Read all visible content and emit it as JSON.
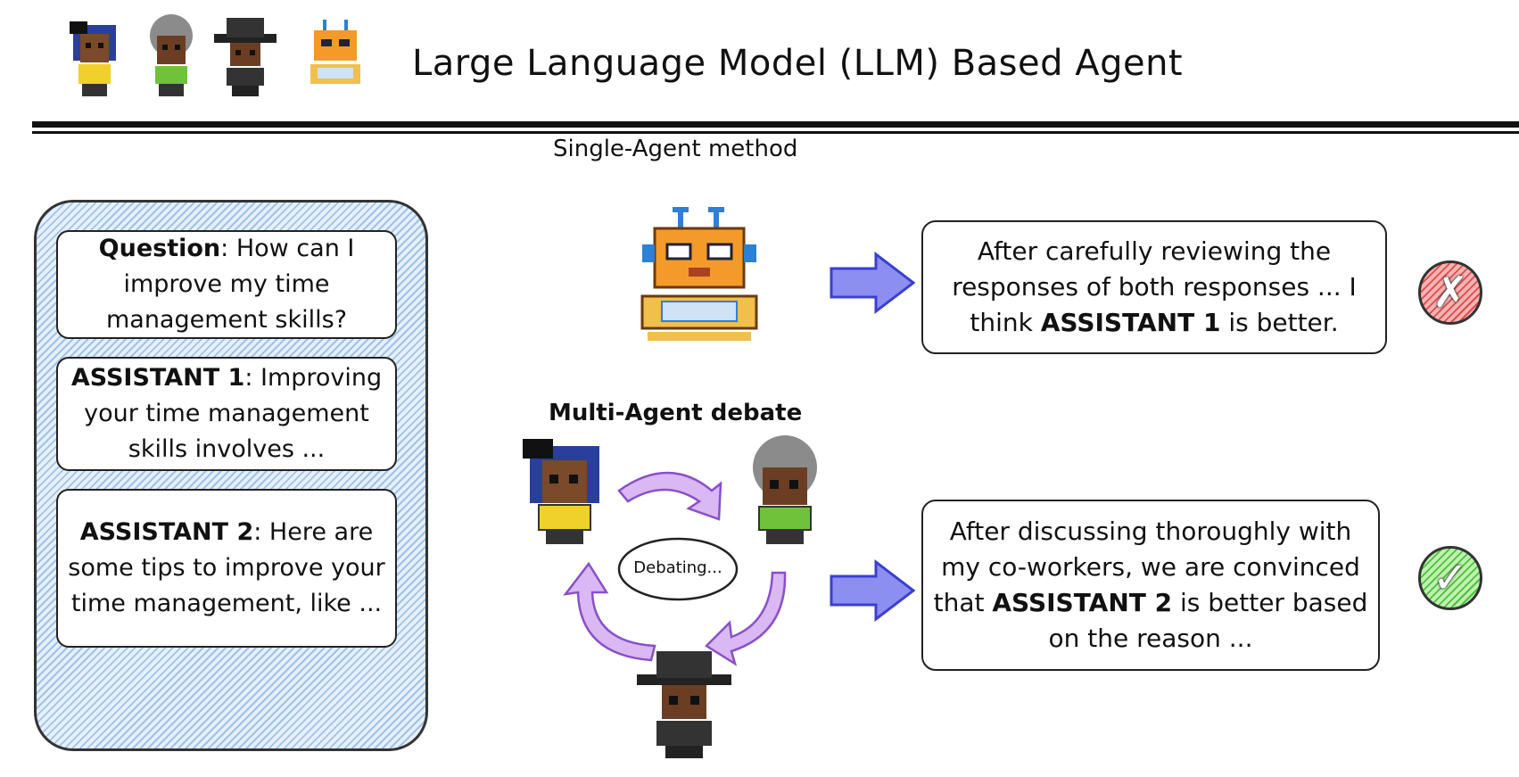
{
  "header": {
    "title": "Large Language Model (LLM) Based Agent",
    "icons": [
      "girl-agent-icon",
      "grandma-agent-icon",
      "hat-agent-icon",
      "robot-icon"
    ]
  },
  "single_agent": {
    "label": "Single-Agent method",
    "response": {
      "pre": "After carefully reviewing the responses of both responses ... I think",
      "bold": "ASSISTANT 1",
      "post": "is better."
    },
    "verdict": "✗"
  },
  "multi_agent": {
    "label": "Multi-Agent debate",
    "bubble": "Debating...",
    "response": {
      "pre": "After discussing thoroughly with my co-workers, we are convinced that",
      "bold": "ASSISTANT 2",
      "post": "is better based on the reason ..."
    },
    "verdict": "✓"
  },
  "panel": {
    "question": {
      "label": "Question",
      "text": ": How can I improve my time management skills?"
    },
    "assistant1": {
      "label": "ASSISTANT 1",
      "text": ": Improving your time management skills involves ..."
    },
    "assistant2": {
      "label": "ASSISTANT 2",
      "text": ": Here are some tips to improve your time management, like ..."
    }
  },
  "colors": {
    "panel_blue": "#9fc3ea",
    "arrow_blue": "#3b3fd1",
    "arrow_purple": "#b87ee8",
    "wrong_red": "#e24a4a",
    "right_green": "#4cc13a"
  }
}
